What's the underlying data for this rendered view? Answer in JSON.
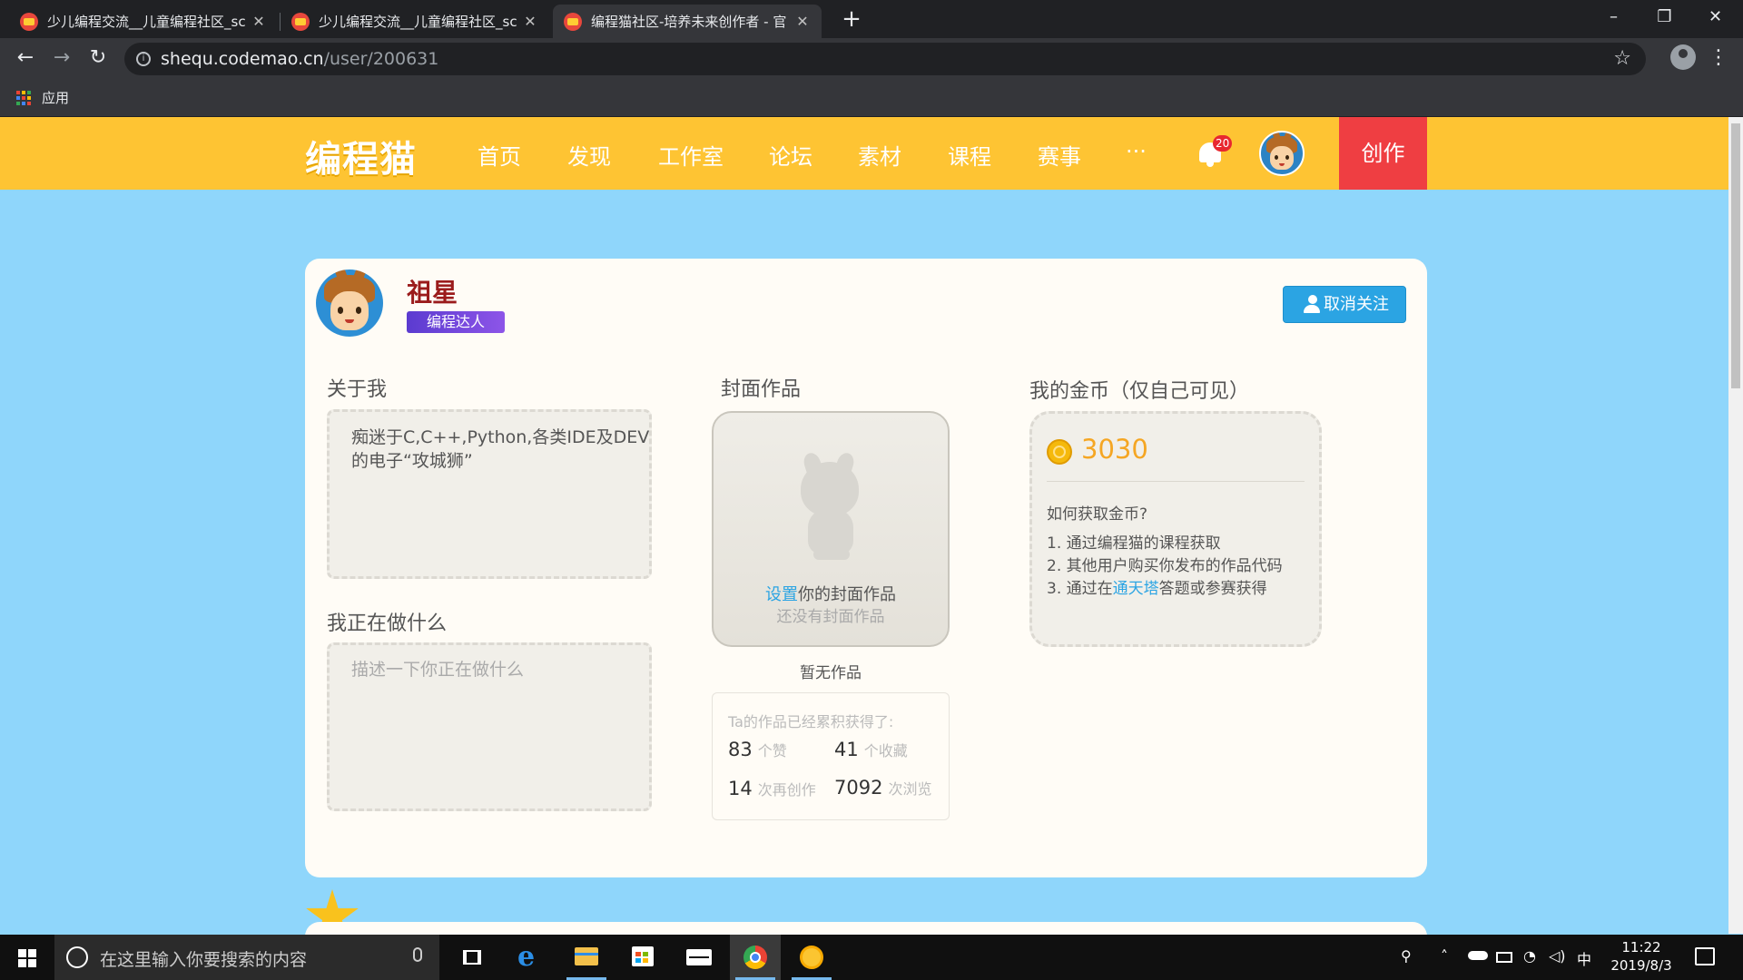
{
  "browser": {
    "tabs": [
      {
        "title": "少儿编程交流__儿童编程社区_sc",
        "close": "✕"
      },
      {
        "title": "少儿编程交流__儿童编程社区_sc",
        "close": "✕"
      },
      {
        "title": "编程猫社区-培养未来创作者 - 官",
        "close": "✕"
      }
    ],
    "new_tab": "+",
    "url_host": "shequ.codemao.cn",
    "url_path": "/user/200631",
    "bookmarks_apps_label": "应用"
  },
  "site": {
    "logo": "编程猫",
    "nav": [
      "首页",
      "发现",
      "工作室",
      "论坛",
      "素材",
      "课程",
      "赛事",
      "···"
    ],
    "notification_count": "20",
    "create_label": "创作"
  },
  "profile": {
    "name": "祖星",
    "title_badge": "编程达人",
    "unfollow_label": "取消关注",
    "about_label": "关于我",
    "about_text": "痴迷于C,C++,Python,各类IDE及DEV的电子“攻城狮”",
    "doing_label": "我正在做什么",
    "doing_placeholder": "描述一下你正在做什么",
    "cover_label": "封面作品",
    "cover_link": "设置",
    "cover_line1_rest": "你的封面作品",
    "cover_line2": "还没有封面作品",
    "no_works": "暂无作品",
    "stats_title": "Ta的作品已经累积获得了:",
    "stats": [
      {
        "value": "83",
        "unit": "个赞"
      },
      {
        "value": "41",
        "unit": "个收藏"
      },
      {
        "value": "14",
        "unit": "次再创作"
      },
      {
        "value": "7092",
        "unit": "次浏览"
      }
    ],
    "coins_label": "我的金币（仅自己可见）",
    "coins_value": "3030",
    "coins_question": "如何获取金币?",
    "coins_ways": [
      {
        "prefix": "1. 通过编程猫的课程获取",
        "link": "",
        "suffix": ""
      },
      {
        "prefix": "2. 其他用户购买你发布的作品代码",
        "link": "",
        "suffix": ""
      },
      {
        "prefix": "3. 通过在",
        "link": "通天塔",
        "suffix": "答题或参赛获得"
      }
    ]
  },
  "taskbar": {
    "search_placeholder": "在这里输入你要搜索的内容",
    "ime": "中",
    "time": "11:22",
    "date": "2019/8/3"
  },
  "colors": {
    "header_yellow": "#fec433",
    "page_bg": "#8fd6fb",
    "create_red": "#ef3e42",
    "follow_blue": "#2ba4e3",
    "coin_orange": "#f5a623",
    "name_red": "#9b1c1c"
  }
}
